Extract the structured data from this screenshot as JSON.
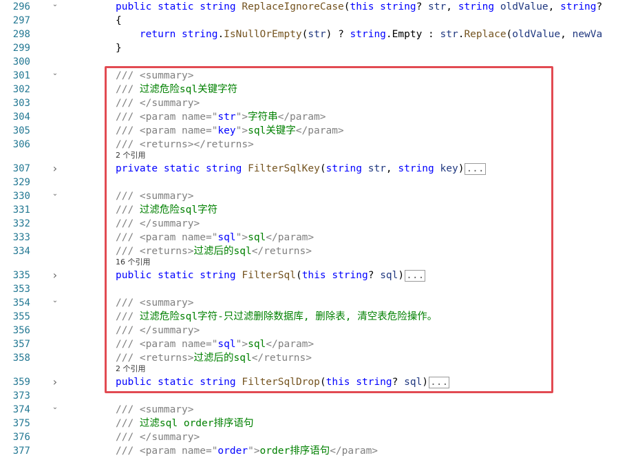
{
  "editor": {
    "lines": [
      {
        "num": "296",
        "fold": "open",
        "kind": "code",
        "tokens": [
          {
            "t": "public",
            "c": "kw"
          },
          {
            "t": " "
          },
          {
            "t": "static",
            "c": "kw"
          },
          {
            "t": " "
          },
          {
            "t": "string",
            "c": "ty"
          },
          {
            "t": " "
          },
          {
            "t": "ReplaceIgnoreCase",
            "c": "fn"
          },
          {
            "t": "("
          },
          {
            "t": "this",
            "c": "kw"
          },
          {
            "t": " "
          },
          {
            "t": "string",
            "c": "ty"
          },
          {
            "t": "? "
          },
          {
            "t": "str",
            "c": "pm"
          },
          {
            "t": ", "
          },
          {
            "t": "string",
            "c": "ty"
          },
          {
            "t": " "
          },
          {
            "t": "oldValue",
            "c": "pm"
          },
          {
            "t": ", "
          },
          {
            "t": "string",
            "c": "ty"
          },
          {
            "t": "?"
          }
        ]
      },
      {
        "num": "297",
        "fold": "",
        "kind": "code",
        "tokens": [
          {
            "t": "{"
          }
        ]
      },
      {
        "num": "298",
        "fold": "",
        "kind": "code",
        "tokens": [
          {
            "t": "    "
          },
          {
            "t": "return",
            "c": "kw"
          },
          {
            "t": " "
          },
          {
            "t": "string",
            "c": "ty"
          },
          {
            "t": "."
          },
          {
            "t": "IsNullOrEmpty",
            "c": "fn"
          },
          {
            "t": "("
          },
          {
            "t": "str",
            "c": "pm"
          },
          {
            "t": ") ? "
          },
          {
            "t": "string",
            "c": "ty"
          },
          {
            "t": ".Empty : "
          },
          {
            "t": "str",
            "c": "pm"
          },
          {
            "t": "."
          },
          {
            "t": "Replace",
            "c": "fn"
          },
          {
            "t": "("
          },
          {
            "t": "oldValue",
            "c": "pm"
          },
          {
            "t": ", "
          },
          {
            "t": "newVa",
            "c": "pm"
          }
        ]
      },
      {
        "num": "299",
        "fold": "",
        "kind": "code",
        "tokens": [
          {
            "t": "}"
          }
        ]
      },
      {
        "num": "300",
        "fold": "",
        "kind": "code",
        "tokens": []
      },
      {
        "num": "301",
        "fold": "open",
        "kind": "code",
        "tokens": [
          {
            "t": "/// ",
            "c": "xg"
          },
          {
            "t": "<summary>",
            "c": "xg"
          }
        ]
      },
      {
        "num": "302",
        "fold": "",
        "kind": "code",
        "tokens": [
          {
            "t": "/// ",
            "c": "xg"
          },
          {
            "t": "过滤危险sql关键字符",
            "c": "cm"
          }
        ]
      },
      {
        "num": "303",
        "fold": "",
        "kind": "code",
        "tokens": [
          {
            "t": "/// ",
            "c": "xg"
          },
          {
            "t": "</summary>",
            "c": "xg"
          }
        ]
      },
      {
        "num": "304",
        "fold": "",
        "kind": "code",
        "tokens": [
          {
            "t": "/// ",
            "c": "xg"
          },
          {
            "t": "<param name=",
            "c": "xg"
          },
          {
            "t": "\"",
            "c": "xg"
          },
          {
            "t": "str",
            "c": "xs"
          },
          {
            "t": "\"",
            "c": "xg"
          },
          {
            "t": ">",
            "c": "xg"
          },
          {
            "t": "字符串",
            "c": "cm"
          },
          {
            "t": "</param>",
            "c": "xg"
          }
        ]
      },
      {
        "num": "305",
        "fold": "",
        "kind": "code",
        "tokens": [
          {
            "t": "/// ",
            "c": "xg"
          },
          {
            "t": "<param name=",
            "c": "xg"
          },
          {
            "t": "\"",
            "c": "xg"
          },
          {
            "t": "key",
            "c": "xs"
          },
          {
            "t": "\"",
            "c": "xg"
          },
          {
            "t": ">",
            "c": "xg"
          },
          {
            "t": "sql关键字",
            "c": "cm"
          },
          {
            "t": "</param>",
            "c": "xg"
          }
        ]
      },
      {
        "num": "306",
        "fold": "",
        "kind": "code",
        "tokens": [
          {
            "t": "/// ",
            "c": "xg"
          },
          {
            "t": "<returns></returns>",
            "c": "xg"
          }
        ]
      },
      {
        "num": "",
        "fold": "",
        "kind": "lens",
        "text": "2 个引用"
      },
      {
        "num": "307",
        "fold": "closed",
        "kind": "code",
        "tokens": [
          {
            "t": "private",
            "c": "kw"
          },
          {
            "t": " "
          },
          {
            "t": "static",
            "c": "kw"
          },
          {
            "t": " "
          },
          {
            "t": "string",
            "c": "ty"
          },
          {
            "t": " "
          },
          {
            "t": "FilterSqlKey",
            "c": "fn"
          },
          {
            "t": "("
          },
          {
            "t": "string",
            "c": "ty"
          },
          {
            "t": " "
          },
          {
            "t": "str",
            "c": "pm"
          },
          {
            "t": ", "
          },
          {
            "t": "string",
            "c": "ty"
          },
          {
            "t": " "
          },
          {
            "t": "key",
            "c": "pm"
          },
          {
            "t": ")"
          },
          {
            "t": "...",
            "c": "collapsed"
          }
        ]
      },
      {
        "num": "329",
        "fold": "",
        "kind": "code",
        "tokens": []
      },
      {
        "num": "330",
        "fold": "open",
        "kind": "code",
        "tokens": [
          {
            "t": "/// ",
            "c": "xg"
          },
          {
            "t": "<summary>",
            "c": "xg"
          }
        ]
      },
      {
        "num": "331",
        "fold": "",
        "kind": "code",
        "tokens": [
          {
            "t": "/// ",
            "c": "xg"
          },
          {
            "t": "过滤危险sql字符",
            "c": "cm"
          }
        ]
      },
      {
        "num": "332",
        "fold": "",
        "kind": "code",
        "tokens": [
          {
            "t": "/// ",
            "c": "xg"
          },
          {
            "t": "</summary>",
            "c": "xg"
          }
        ]
      },
      {
        "num": "333",
        "fold": "",
        "kind": "code",
        "tokens": [
          {
            "t": "/// ",
            "c": "xg"
          },
          {
            "t": "<param name=",
            "c": "xg"
          },
          {
            "t": "\"",
            "c": "xg"
          },
          {
            "t": "sql",
            "c": "xs"
          },
          {
            "t": "\"",
            "c": "xg"
          },
          {
            "t": ">",
            "c": "xg"
          },
          {
            "t": "sql",
            "c": "cm"
          },
          {
            "t": "</param>",
            "c": "xg"
          }
        ]
      },
      {
        "num": "334",
        "fold": "",
        "kind": "code",
        "tokens": [
          {
            "t": "/// ",
            "c": "xg"
          },
          {
            "t": "<returns>",
            "c": "xg"
          },
          {
            "t": "过滤后的sql",
            "c": "cm"
          },
          {
            "t": "</returns>",
            "c": "xg"
          }
        ]
      },
      {
        "num": "",
        "fold": "",
        "kind": "lens",
        "text": "16 个引用"
      },
      {
        "num": "335",
        "fold": "closed",
        "kind": "code",
        "tokens": [
          {
            "t": "public",
            "c": "kw"
          },
          {
            "t": " "
          },
          {
            "t": "static",
            "c": "kw"
          },
          {
            "t": " "
          },
          {
            "t": "string",
            "c": "ty"
          },
          {
            "t": " "
          },
          {
            "t": "FilterSql",
            "c": "fn"
          },
          {
            "t": "("
          },
          {
            "t": "this",
            "c": "kw"
          },
          {
            "t": " "
          },
          {
            "t": "string",
            "c": "ty"
          },
          {
            "t": "? "
          },
          {
            "t": "sql",
            "c": "pm"
          },
          {
            "t": ")"
          },
          {
            "t": "...",
            "c": "collapsed"
          }
        ]
      },
      {
        "num": "353",
        "fold": "",
        "kind": "code",
        "tokens": []
      },
      {
        "num": "354",
        "fold": "open",
        "kind": "code",
        "tokens": [
          {
            "t": "/// ",
            "c": "xg"
          },
          {
            "t": "<summary>",
            "c": "xg"
          }
        ]
      },
      {
        "num": "355",
        "fold": "",
        "kind": "code",
        "tokens": [
          {
            "t": "/// ",
            "c": "xg"
          },
          {
            "t": "过滤危险sql字符-只过滤删除数据库, 删除表, 清空表危险操作。",
            "c": "cm"
          }
        ]
      },
      {
        "num": "356",
        "fold": "",
        "kind": "code",
        "tokens": [
          {
            "t": "/// ",
            "c": "xg"
          },
          {
            "t": "</summary>",
            "c": "xg"
          }
        ]
      },
      {
        "num": "357",
        "fold": "",
        "kind": "code",
        "tokens": [
          {
            "t": "/// ",
            "c": "xg"
          },
          {
            "t": "<param name=",
            "c": "xg"
          },
          {
            "t": "\"",
            "c": "xg"
          },
          {
            "t": "sql",
            "c": "xs"
          },
          {
            "t": "\"",
            "c": "xg"
          },
          {
            "t": ">",
            "c": "xg"
          },
          {
            "t": "sql",
            "c": "cm"
          },
          {
            "t": "</param>",
            "c": "xg"
          }
        ]
      },
      {
        "num": "358",
        "fold": "",
        "kind": "code",
        "tokens": [
          {
            "t": "/// ",
            "c": "xg"
          },
          {
            "t": "<returns>",
            "c": "xg"
          },
          {
            "t": "过滤后的sql",
            "c": "cm"
          },
          {
            "t": "</returns>",
            "c": "xg"
          }
        ]
      },
      {
        "num": "",
        "fold": "",
        "kind": "lens",
        "text": "2 个引用"
      },
      {
        "num": "359",
        "fold": "closed",
        "kind": "code",
        "tokens": [
          {
            "t": "public",
            "c": "kw"
          },
          {
            "t": " "
          },
          {
            "t": "static",
            "c": "kw"
          },
          {
            "t": " "
          },
          {
            "t": "string",
            "c": "ty"
          },
          {
            "t": " "
          },
          {
            "t": "FilterSqlDrop",
            "c": "fn"
          },
          {
            "t": "("
          },
          {
            "t": "this",
            "c": "kw"
          },
          {
            "t": " "
          },
          {
            "t": "string",
            "c": "ty"
          },
          {
            "t": "? "
          },
          {
            "t": "sql",
            "c": "pm"
          },
          {
            "t": ")"
          },
          {
            "t": "...",
            "c": "collapsed"
          }
        ]
      },
      {
        "num": "373",
        "fold": "",
        "kind": "code",
        "tokens": []
      },
      {
        "num": "374",
        "fold": "open",
        "kind": "code",
        "tokens": [
          {
            "t": "/// ",
            "c": "xg"
          },
          {
            "t": "<summary>",
            "c": "xg"
          }
        ]
      },
      {
        "num": "375",
        "fold": "",
        "kind": "code",
        "tokens": [
          {
            "t": "/// ",
            "c": "xg"
          },
          {
            "t": "过滤sql order排序语句",
            "c": "cm"
          }
        ]
      },
      {
        "num": "376",
        "fold": "",
        "kind": "code",
        "tokens": [
          {
            "t": "/// ",
            "c": "xg"
          },
          {
            "t": "</summary>",
            "c": "xg"
          }
        ]
      },
      {
        "num": "377",
        "fold": "",
        "kind": "code",
        "tokens": [
          {
            "t": "/// ",
            "c": "xg"
          },
          {
            "t": "<param name=",
            "c": "xg"
          },
          {
            "t": "\"",
            "c": "xg"
          },
          {
            "t": "order",
            "c": "xs"
          },
          {
            "t": "\"",
            "c": "xg"
          },
          {
            "t": ">",
            "c": "xg"
          },
          {
            "t": "order排序语句",
            "c": "cm"
          },
          {
            "t": "</param>",
            "c": "xg"
          }
        ]
      }
    ]
  },
  "colors": {
    "highlight_border": "#e24a52",
    "line_number": "#237893",
    "keyword": "#0000ff",
    "method": "#74531f",
    "parameter": "#1f377f",
    "comment": "#008000",
    "doc_tag": "#808080"
  },
  "icons": {
    "fold_open": "chevron-down-icon",
    "fold_closed": "chevron-right-icon"
  }
}
